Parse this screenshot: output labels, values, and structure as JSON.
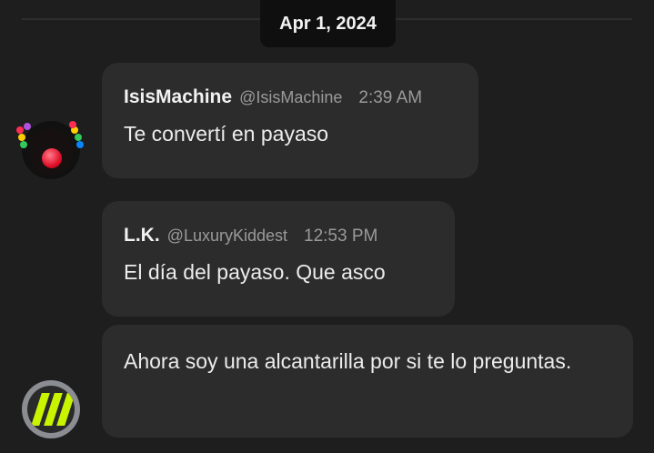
{
  "date_separator": "Apr 1, 2024",
  "messages": [
    {
      "author": "IsisMachine",
      "handle": "@IsisMachine",
      "time": "2:39 AM",
      "text": "Te convertí en payaso",
      "avatar": "clown-avatar"
    },
    {
      "author": "L.K.",
      "handle": "@LuxuryKiddest",
      "time": "12:53 PM",
      "text": "El día del payaso. Que asco",
      "avatar": null
    },
    {
      "author": "",
      "handle": "",
      "time": "",
      "text": "Ahora soy una alcantarilla por si te lo preguntas.",
      "avatar": "sewer-avatar"
    }
  ],
  "colors": {
    "background": "#1e1e1e",
    "bubble": "#2c2c2c",
    "date_pill": "#0f0f0f",
    "muted_text": "#9a9a9a",
    "sewer_stripe": "#c8f400",
    "clown_nose": "#e0102a"
  }
}
